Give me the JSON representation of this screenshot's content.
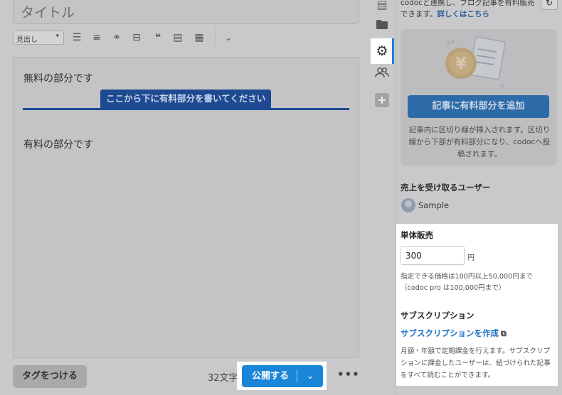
{
  "editor": {
    "title_placeholder": "タイトル",
    "toolbar": {
      "format_select": "見出し",
      "icons": [
        "bulleted-list",
        "numbered-list",
        "link",
        "horizontal-rule",
        "quote",
        "list-box",
        "table",
        "more"
      ]
    },
    "free_text": "無料の部分です",
    "paid_divider_label": "ここから下に有料部分を書いてください",
    "paid_text": "有料の部分です"
  },
  "footer": {
    "tag_button": "タグをつける",
    "char_count": "32文字",
    "publish_button": "公開する",
    "more": "•••"
  },
  "panel": {
    "top_text": "codocと連携し、ブログ記事を有料販売できます。",
    "top_link": "詳しくはこちら",
    "add_paid_button": "記事に有料部分を追加",
    "paid_desc": "記事内に区切り線が挿入されます。区切り線から下部が有料部分になり、codocへ投稿されます。",
    "recipient_title": "売上を受け取るユーザー",
    "recipient_name": "Sample",
    "single_sale_title": "単体販売",
    "price_value": "300",
    "price_unit": "円",
    "price_note": "指定できる価格は100円以上50,000円まで（codoc pro は100,000円まで）",
    "subscription_title": "サブスクリプション",
    "subscription_link": "サブスクリプションを作成",
    "subscription_desc": "月額・年額で定期課金を行えます。サブスクリプションに課金したユーザーは、紐づけられた記事をすべて読むことができます。"
  },
  "colors": {
    "accent": "#1a86d8",
    "paid_divider": "#1e4a91",
    "link": "#1f6fc4"
  }
}
